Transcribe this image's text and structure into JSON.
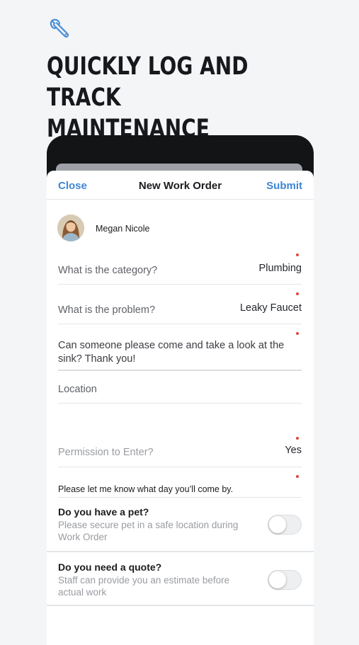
{
  "hero": {
    "icon": "wrench-icon",
    "headline": "QUICKLY LOG AND TRACK MAINTENANCE REQUESTS"
  },
  "navbar": {
    "close_label": "Close",
    "title": "New Work Order",
    "submit_label": "Submit",
    "accent_color": "#3f86d6"
  },
  "user": {
    "name": "Megan Nicole"
  },
  "form": {
    "category": {
      "label": "What is the category?",
      "value": "Plumbing"
    },
    "problem": {
      "label": "What is the problem?",
      "value": "Leaky Faucet"
    },
    "comment": "Can someone please come and take a look at the sink? Thank you!",
    "location_placeholder": "Location",
    "permission": {
      "label": "Permission to Enter?",
      "value": "Yes"
    },
    "schedule_note": "Please let me know what day you’ll come by.",
    "pet": {
      "title": "Do you have a pet?",
      "description": "Please secure pet in a safe location during Work Order",
      "enabled": false
    },
    "quote": {
      "title": "Do you need a quote?",
      "description": "Staff can provide you an estimate before actual work",
      "enabled": false
    },
    "required_color": "#e0463b"
  }
}
